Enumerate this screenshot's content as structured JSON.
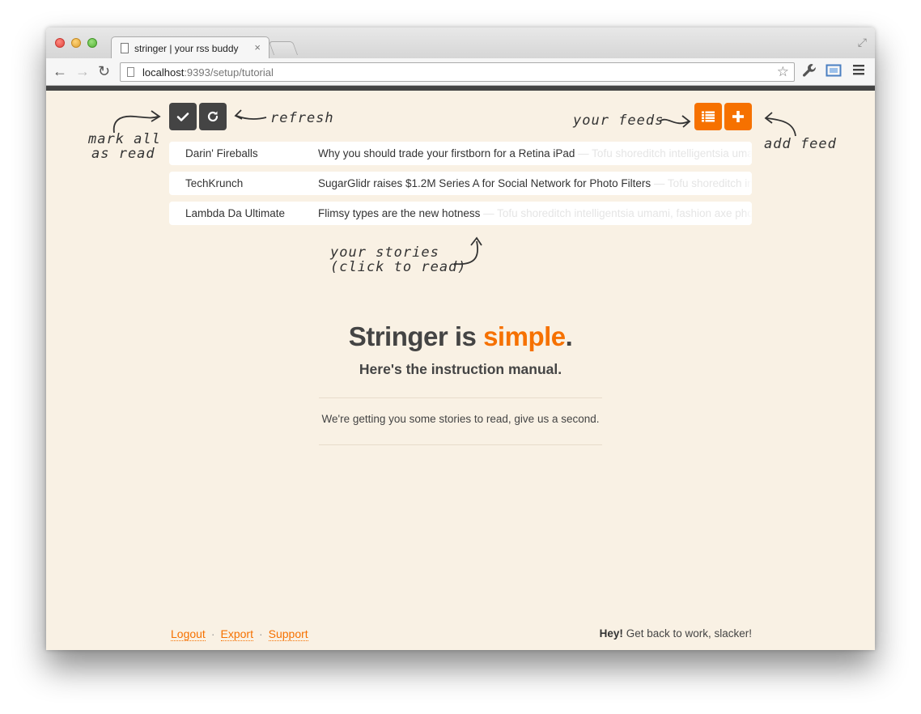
{
  "browser": {
    "tab_title": "stringer | your rss buddy",
    "tab_close": "×",
    "url_host": "localhost",
    "url_rest": ":9393/setup/tutorial",
    "icons": [
      "back-icon",
      "forward-icon",
      "reload-icon",
      "page-icon",
      "star-icon",
      "wrench-icon",
      "cast-icon",
      "menu-icon",
      "fullscreen-icon"
    ]
  },
  "toolbar": {
    "mark_all_read_icon": "check-icon",
    "refresh_icon": "refresh-icon",
    "feeds_icon": "list-icon",
    "add_feed_icon": "plus-icon"
  },
  "annotations": {
    "mark_all_line1": "mark all",
    "mark_all_line2": "as read",
    "refresh": "refresh",
    "your_feeds": "your feeds",
    "add_feed": "add feed",
    "stories_line1": "your stories",
    "stories_line2": "(click to read)"
  },
  "stories": [
    {
      "feed": "Darin' Fireballs",
      "title": "Why you should trade your firstborn for a Retina iPad",
      "excerpt": " — Tofu shoreditch intelligentsia umami, fashion axe photo booth"
    },
    {
      "feed": "TechKrunch",
      "title": "SugarGlidr raises $1.2M Series A for Social Network for Photo Filters",
      "excerpt": " — Tofu shoreditch intelligentsia umami, fashion axe photo booth"
    },
    {
      "feed": "Lambda Da Ultimate",
      "title": "Flimsy types are the new hotness",
      "excerpt": " — Tofu shoreditch intelligentsia umami, fashion axe photo booth"
    }
  ],
  "main": {
    "title_prefix": "Stringer is ",
    "title_accent": "simple",
    "title_suffix": ".",
    "subtitle": "Here's the instruction manual.",
    "waiting_message": "We're getting you some stories to read, give us a second."
  },
  "footer": {
    "logout": "Logout",
    "export": "Export",
    "support": "Support",
    "separator": "·",
    "hey": "Hey!",
    "message": " Get back to work, slacker!"
  },
  "colors": {
    "accent": "#f67100",
    "background": "#f9f1e4",
    "dark_button": "#444444"
  }
}
